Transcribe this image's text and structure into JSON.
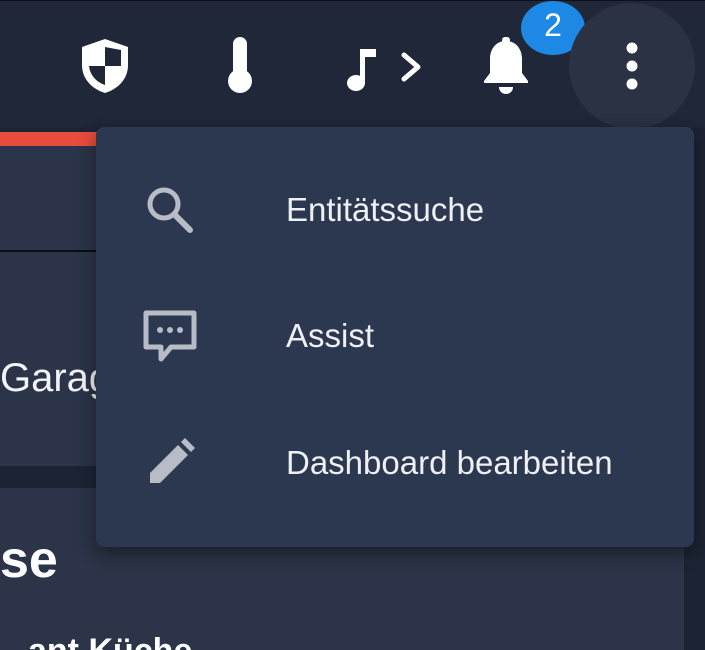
{
  "topbar": {
    "icons": [
      "shield-icon",
      "thermometer-icon",
      "music-note-icon",
      "chevron-right-icon",
      "bell-icon",
      "more-vertical-icon"
    ],
    "notification_count": "2"
  },
  "background": {
    "garage_text": "Garag",
    "heading": "se",
    "partial_text": "ant Küche"
  },
  "menu": {
    "items": [
      {
        "label": "Entitätssuche",
        "icon": "search-icon"
      },
      {
        "label": "Assist",
        "icon": "chat-icon"
      },
      {
        "label": "Dashboard bearbeiten",
        "icon": "pencil-icon"
      }
    ]
  },
  "colors": {
    "background": "#1c2434",
    "topbar": "#1f2738",
    "menu": "#2c3750",
    "badge": "#1e88e5",
    "accent_red": "#e74c3c",
    "icon_gray": "#b8bcc6"
  }
}
